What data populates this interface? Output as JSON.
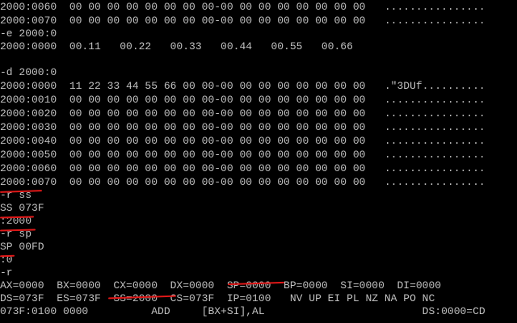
{
  "terminal": {
    "lines": [
      "2000:0060  00 00 00 00 00 00 00 00-00 00 00 00 00 00 00 00   ................",
      "2000:0070  00 00 00 00 00 00 00 00-00 00 00 00 00 00 00 00   ................",
      "-e 2000:0",
      "2000:0000  00.11   00.22   00.33   00.44   00.55   00.66",
      "",
      "-d 2000:0",
      "2000:0000  11 22 33 44 55 66 00 00-00 00 00 00 00 00 00 00   .\"3DUf..........",
      "2000:0010  00 00 00 00 00 00 00 00-00 00 00 00 00 00 00 00   ................",
      "2000:0020  00 00 00 00 00 00 00 00-00 00 00 00 00 00 00 00   ................",
      "2000:0030  00 00 00 00 00 00 00 00-00 00 00 00 00 00 00 00   ................",
      "2000:0040  00 00 00 00 00 00 00 00-00 00 00 00 00 00 00 00   ................",
      "2000:0050  00 00 00 00 00 00 00 00-00 00 00 00 00 00 00 00   ................",
      "2000:0060  00 00 00 00 00 00 00 00-00 00 00 00 00 00 00 00   ................",
      "2000:0070  00 00 00 00 00 00 00 00-00 00 00 00 00 00 00 00   ................",
      "-r ss",
      "SS 073F",
      ":2000",
      "-r sp",
      "SP 00FD",
      ":0",
      "-r",
      "AX=0000  BX=0000  CX=0000  DX=0000  SP=0000  BP=0000  SI=0000  DI=0000",
      "DS=073F  ES=073F  SS=2000  CS=073F  IP=0100   NV UP EI PL NZ NA PO NC",
      "073F:0100 0000          ADD     [BX+SI],AL                         DS:0000=CD",
      "-",
      "↑"
    ]
  }
}
